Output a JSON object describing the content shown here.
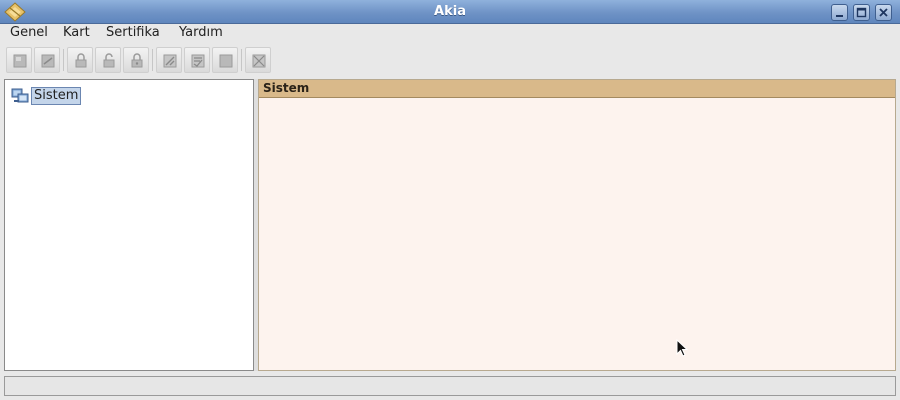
{
  "window": {
    "title": "Akia"
  },
  "menu": {
    "items": [
      {
        "label": "Genel"
      },
      {
        "label": "Kart"
      },
      {
        "label": "Sertifika"
      },
      {
        "label": "Yardım"
      }
    ]
  },
  "tree": {
    "root": {
      "label": "Sistem",
      "icon": "computer-network-icon",
      "selected": true
    }
  },
  "content": {
    "header": "Sistem"
  },
  "status": {
    "text": ""
  },
  "colors": {
    "titlebar": "#6f93c6",
    "content_bg": "#fdf3ee",
    "content_header": "#d9b98a",
    "selection": "#c4d5ea"
  }
}
